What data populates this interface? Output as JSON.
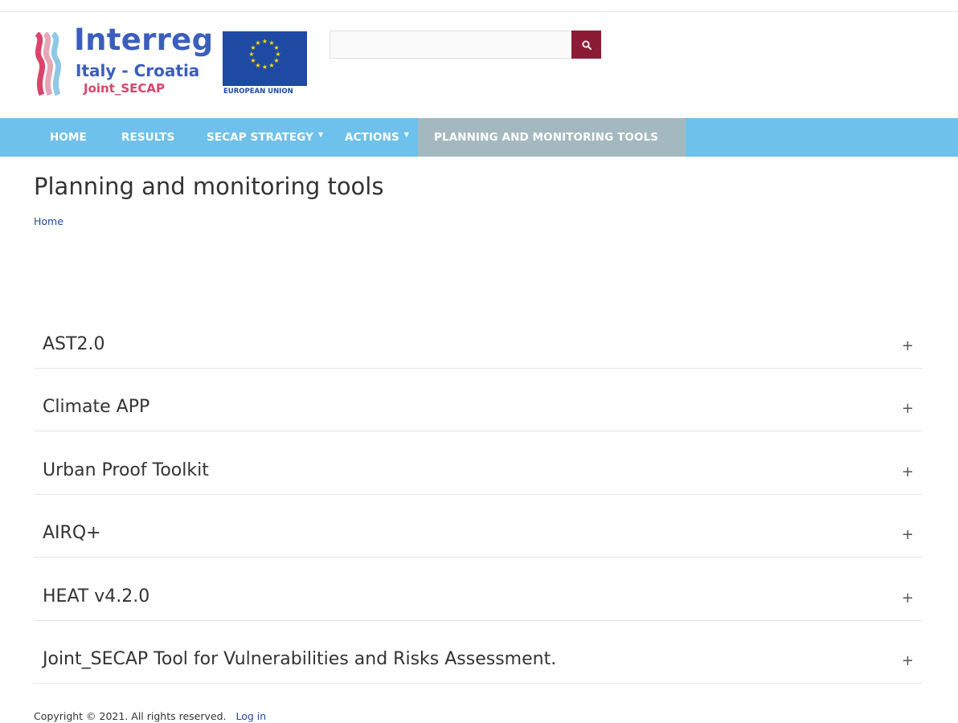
{
  "brand": {
    "logo_title": "Interreg",
    "logo_subtitle": "Italy - Croatia",
    "logo_project": "Joint_SECAP",
    "eu_label": "EUROPEAN UNION",
    "colors": {
      "logo_blue": "#3b5ebd",
      "logo_pink": "#d9456a",
      "eu_blue": "#1f4aa3",
      "eu_star": "#ffdd00"
    }
  },
  "search": {
    "value": "",
    "placeholder": "",
    "button_icon": "search-icon",
    "button_color": "#8c1c35"
  },
  "nav": {
    "background": "#6ec1ea",
    "active_background": "#a4b9bf",
    "items": [
      {
        "label": "HOME",
        "has_dropdown": false,
        "active": false
      },
      {
        "label": "RESULTS",
        "has_dropdown": false,
        "active": false
      },
      {
        "label": "SECAP STRATEGY",
        "has_dropdown": true,
        "active": false
      },
      {
        "label": "ACTIONS",
        "has_dropdown": true,
        "active": false
      },
      {
        "label": "PLANNING AND MONITORING TOOLS",
        "has_dropdown": false,
        "active": true
      }
    ]
  },
  "page": {
    "title": "Planning and monitoring tools",
    "breadcrumb": "Home"
  },
  "accordion": {
    "toggle_symbol": "+",
    "items": [
      {
        "title": "AST2.0"
      },
      {
        "title": "Climate APP"
      },
      {
        "title": "Urban Proof Toolkit"
      },
      {
        "title": "AIRQ+"
      },
      {
        "title": "HEAT v4.2.0"
      },
      {
        "title": "Joint_SECAP Tool for Vulnerabilities and Risks Assessment."
      }
    ]
  },
  "footer": {
    "copyright": "Copyright © 2021. All rights reserved.",
    "login": "Log in"
  }
}
